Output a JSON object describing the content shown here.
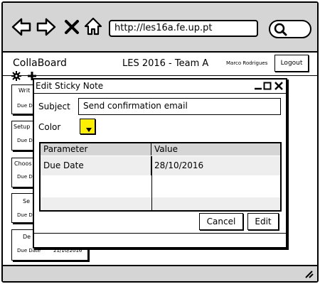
{
  "browser": {
    "url": "http://les16a.fe.up.pt",
    "back_icon": "arrow-left-icon",
    "forward_icon": "arrow-right-icon",
    "stop_icon": "x-icon",
    "home_icon": "home-icon",
    "search_icon": "search-icon"
  },
  "app": {
    "name": "CollaBoard",
    "project": "LES 2016 - Team A",
    "user": "Marco Rodrigues",
    "logout_label": "Logout",
    "settings_icon": "gear-icon",
    "add_icon": "plus-icon"
  },
  "cards": [
    {
      "title": "Writ",
      "due_label": "Due D"
    },
    {
      "title": "Setup",
      "due_label": "Due D"
    },
    {
      "title": "Choos",
      "due_label": "Due D"
    },
    {
      "title": "Se",
      "due_label": "Due D"
    },
    {
      "title": "De",
      "due_label": "Due Date",
      "due_value": "21/10/2016"
    }
  ],
  "dialog": {
    "title": "Edit Sticky Note",
    "subject_label": "Subject",
    "subject_value": "Send confirmation email",
    "color_label": "Color",
    "color_value": "#ffef00",
    "table": {
      "headers": [
        "Parameter",
        "Value"
      ],
      "rows": [
        [
          "Due Date",
          "28/10/2016"
        ]
      ]
    },
    "cancel_label": "Cancel",
    "edit_label": "Edit"
  }
}
